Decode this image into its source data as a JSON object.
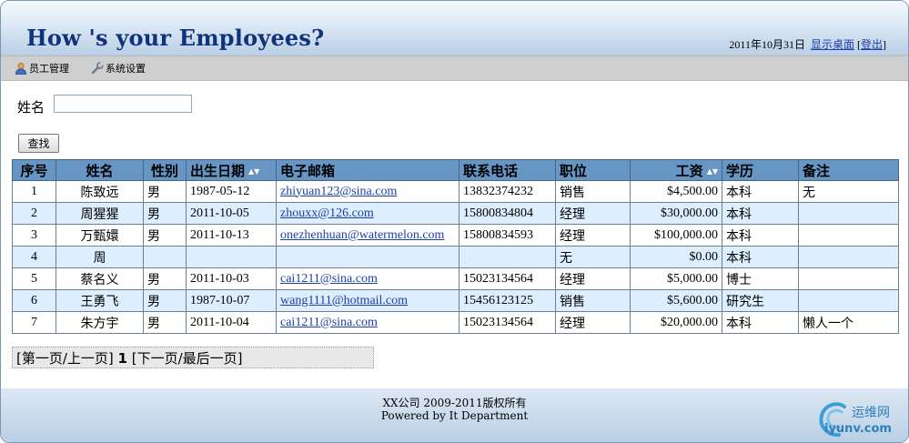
{
  "header": {
    "title": "How 's your Employees?",
    "date": "2011年10月31日",
    "show_desktop": "显示桌面",
    "logout_open": "[",
    "logout": "登出",
    "logout_close": "]"
  },
  "menu": {
    "items": [
      {
        "label": "员工管理",
        "icon": "user-icon"
      },
      {
        "label": "系统设置",
        "icon": "wrench-icon"
      }
    ]
  },
  "search": {
    "label": "姓名",
    "value": "",
    "button": "查找"
  },
  "table": {
    "headers": [
      "序号",
      "姓名",
      "性别",
      "出生日期",
      "电子邮箱",
      "联系电话",
      "职位",
      "工资",
      "学历",
      "备注"
    ],
    "rows": [
      [
        "1",
        "陈致远",
        "男",
        "1987-05-12",
        "zhiyuan123@sina.com",
        "13832374232",
        "销售",
        "$4,500.00",
        "本科",
        "无"
      ],
      [
        "2",
        "周猩猩",
        "男",
        "2011-10-05",
        "zhouxx@126.com",
        "15800834804",
        "经理",
        "$30,000.00",
        "本科",
        ""
      ],
      [
        "3",
        "万甄嬛",
        "男",
        "2011-10-13",
        "onezhenhuan@watermelon.com",
        "15800834593",
        "经理",
        "$100,000.00",
        "本科",
        ""
      ],
      [
        "4",
        "周",
        "",
        "",
        "",
        "",
        "无",
        "$0.00",
        "本科",
        ""
      ],
      [
        "5",
        "蔡名义",
        "男",
        "2011-10-03",
        "cai1211@sina.com",
        "15023134564",
        "经理",
        "$5,000.00",
        "博士",
        ""
      ],
      [
        "6",
        "王勇飞",
        "男",
        "1987-10-07",
        "wang1111@hotmail.com",
        "15456123125",
        "销售",
        "$5,600.00",
        "研究生",
        ""
      ],
      [
        "7",
        "朱方宇",
        "男",
        "2011-10-04",
        "cai1211@sina.com",
        "15023134564",
        "经理",
        "$20,000.00",
        "本科",
        "懒人一个"
      ]
    ]
  },
  "pager": {
    "first": "[第一页",
    "prev": "/上一页]",
    "current": "1",
    "next": "[下一页",
    "last": "/最后一页]"
  },
  "footer": {
    "copyright": "XX公司 2009-2011版权所有",
    "powered": "Powered by It Department"
  },
  "watermark": {
    "name": "运维网",
    "url": "iyunv.com"
  },
  "colors": {
    "title": "#11337a",
    "table_header": "#6796c4",
    "row_alt": "#ddeefe",
    "link": "#1f3fa8"
  }
}
